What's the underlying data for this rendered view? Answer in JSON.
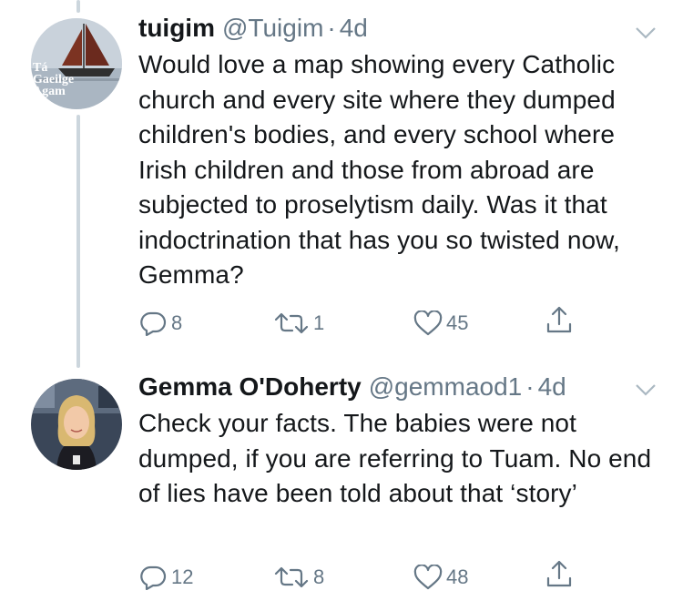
{
  "tweets": [
    {
      "name": "tuigim",
      "handle": "@Tuigim",
      "separator": "·",
      "time": "4d",
      "text": "Would love a map showing every Catholic church and every site where they dumped children's bodies, and every school where Irish children and those from abroad are subjected to proselytism daily. Was it that indoctrination that has you so twisted now, Gemma?",
      "replies": "8",
      "retweets": "1",
      "likes": "45",
      "avatar_text": "Tá Gaeilge Agam"
    },
    {
      "name": "Gemma O'Doherty",
      "handle": "@gemmaod1",
      "separator": "·",
      "time": "4d",
      "text": "Check your facts. The babies were not dumped, if you are referring to Tuam. No end of lies have been told about that ‘story’",
      "replies": "12",
      "retweets": "8",
      "likes": "48"
    }
  ],
  "icons": {
    "reply": "reply-icon",
    "retweet": "retweet-icon",
    "like": "heart-icon",
    "share": "share-icon",
    "more": "chevron-down-icon"
  },
  "colors": {
    "text": "#14171a",
    "secondary": "#657786",
    "thread_line": "#ccd6dd"
  }
}
